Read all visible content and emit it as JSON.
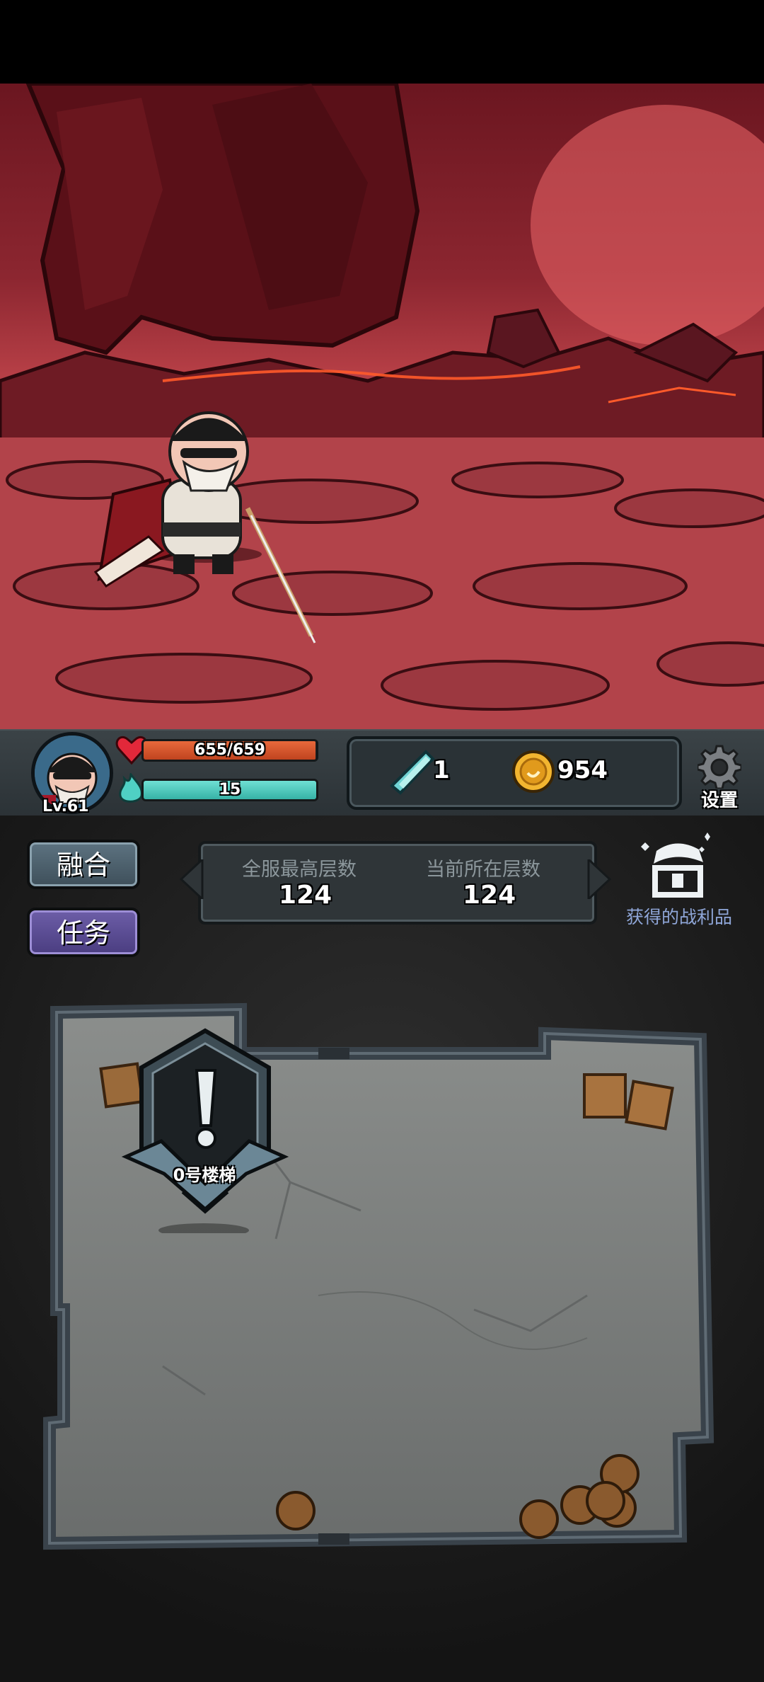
{
  "player": {
    "level": "Lv.61",
    "hp_text": "655/659",
    "hp_fraction": 0.994,
    "mp_text": "15",
    "mp_fraction": 1.0
  },
  "resources": {
    "crystal": "1",
    "gold": "954"
  },
  "settings_label": "设置",
  "buttons": {
    "fuse": "融合",
    "task": "任务"
  },
  "floors": {
    "server_best_label": "全服最高层数",
    "server_best_value": "124",
    "current_label": "当前所在层数",
    "current_value": "124"
  },
  "loot_label": "获得的战利品",
  "map": {
    "stair_label": "0号楼梯"
  },
  "colors": {
    "hp": "#d4542c",
    "mp": "#4fd0c4",
    "accent_purple": "#5a4a94",
    "loot_text": "#8fa6d8"
  }
}
